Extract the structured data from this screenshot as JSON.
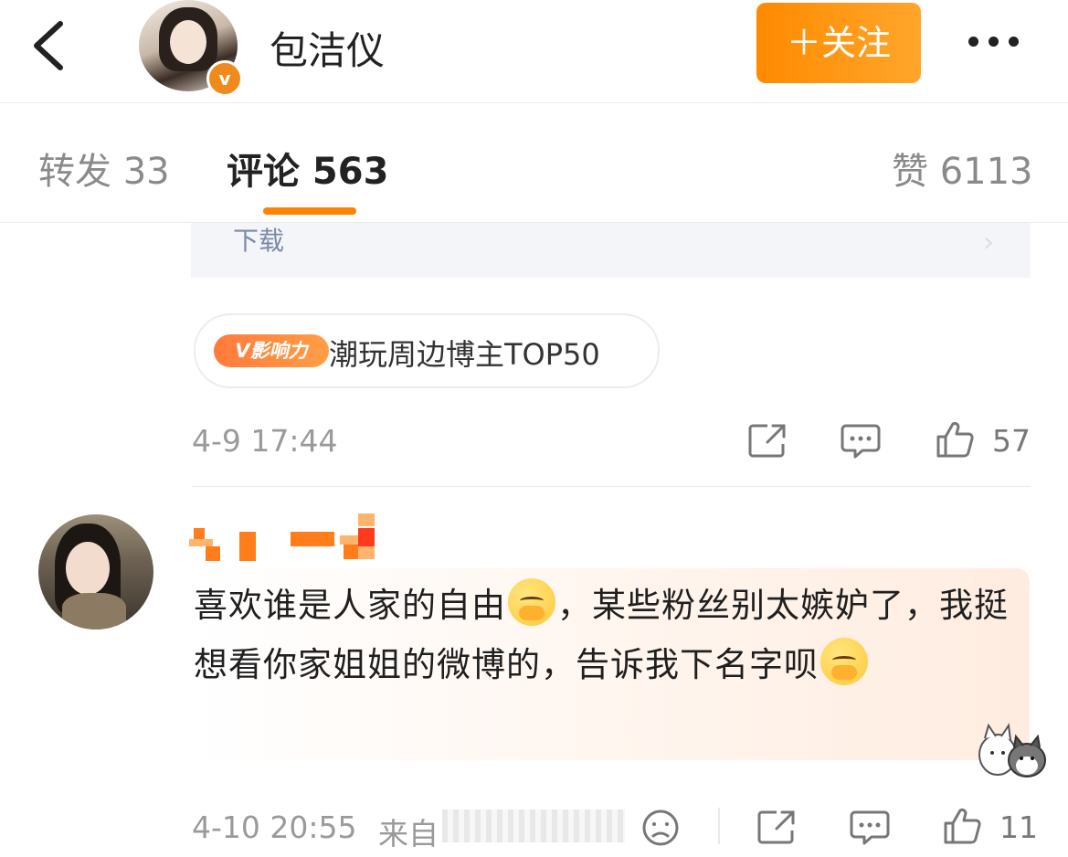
{
  "header": {
    "username": "包洁仪",
    "verified_badge": "v",
    "follow_label": "＋关注",
    "accent_color": "#ff8a00"
  },
  "tabs": [
    {
      "label": "转发 33"
    },
    {
      "label": "评论 563",
      "active": true
    },
    {
      "label": "赞 6113"
    }
  ],
  "post": {
    "card_text": "下载",
    "influence_badge": "V影响力",
    "influence_text": "潮玩周边博主TOP50",
    "timestamp": "4-9 17:44",
    "like_count": "57"
  },
  "comment": {
    "text_parts": [
      "喜欢谁是人家的自由",
      "，某些粉丝别太嫉妒了，我挺想看你家姐姐的微博的，告诉我下名字呗"
    ],
    "emoji": "crying-face-hands-emoji",
    "timestamp": "4-10 20:55",
    "source_prefix": "来自",
    "like_count": "11"
  }
}
